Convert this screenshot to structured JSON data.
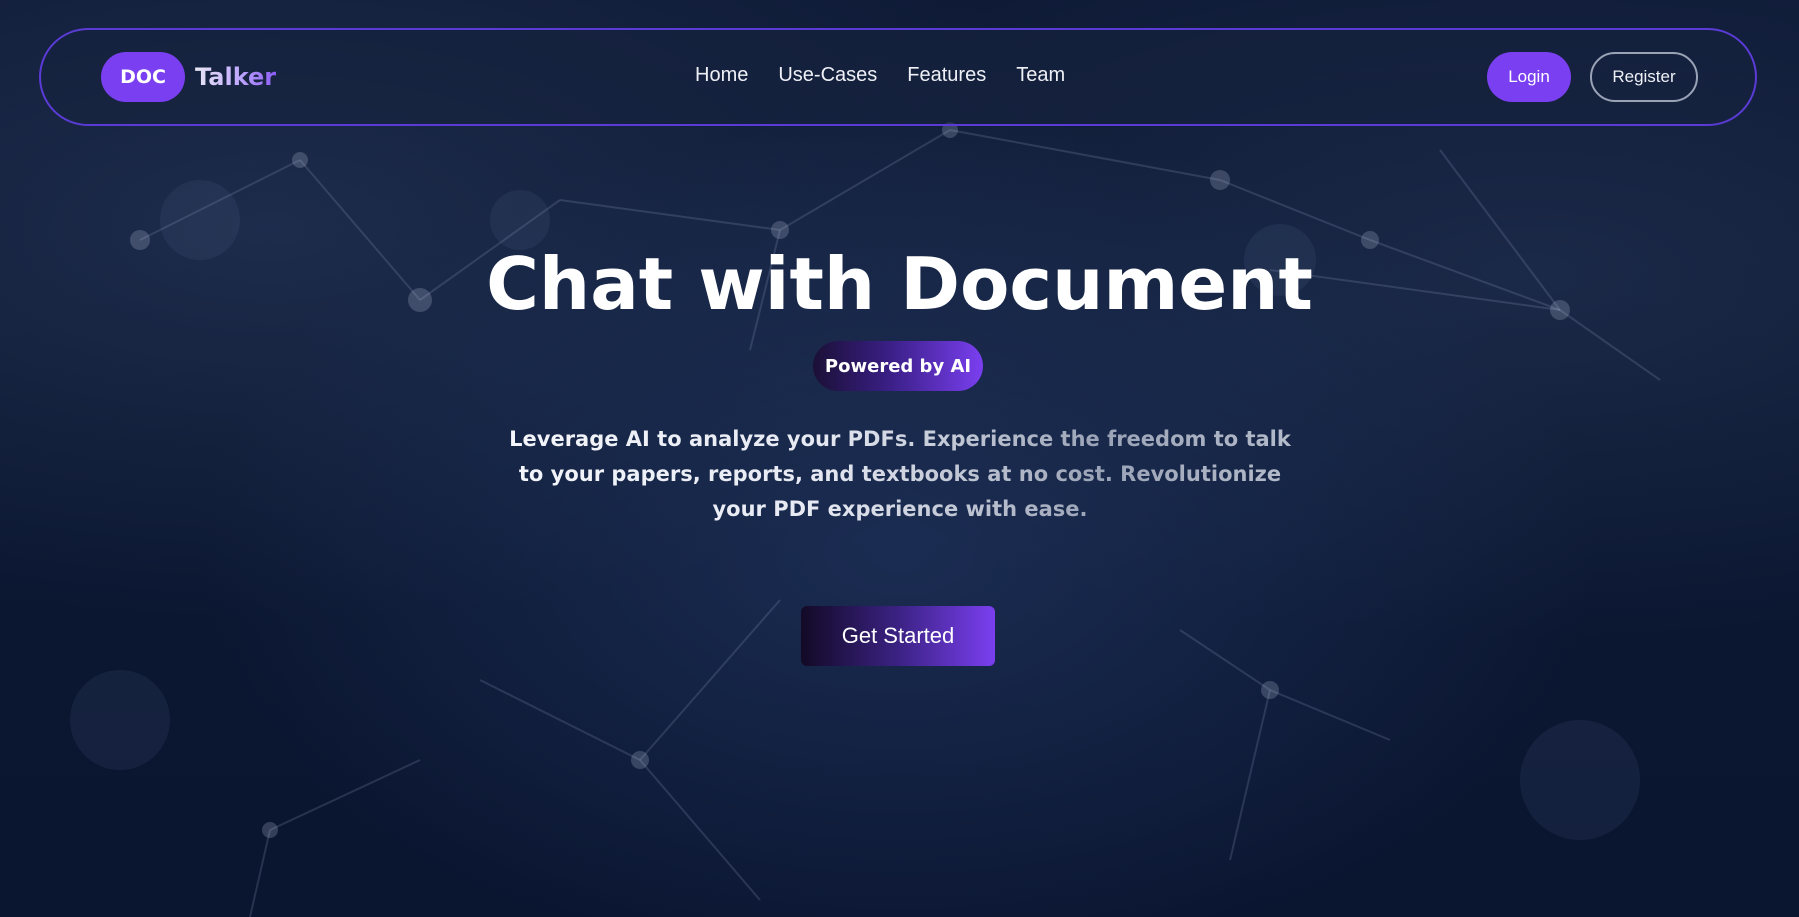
{
  "brand": {
    "badge": "DOC",
    "name": "Talker"
  },
  "nav": {
    "links": [
      {
        "label": "Home"
      },
      {
        "label": "Use-Cases"
      },
      {
        "label": "Features"
      },
      {
        "label": "Team"
      }
    ],
    "login": "Login",
    "register": "Register"
  },
  "hero": {
    "title": "Chat with Document",
    "badge": "Powered by AI",
    "description": "Leverage AI to analyze your PDFs. Experience the freedom to talk to your papers, reports, and textbooks at no cost. Revolutionize your PDF experience with ease.",
    "cta": "Get Started"
  },
  "colors": {
    "accent": "#7a3ff0",
    "nav_border": "#5b3bd6",
    "background": "#0b1630"
  }
}
